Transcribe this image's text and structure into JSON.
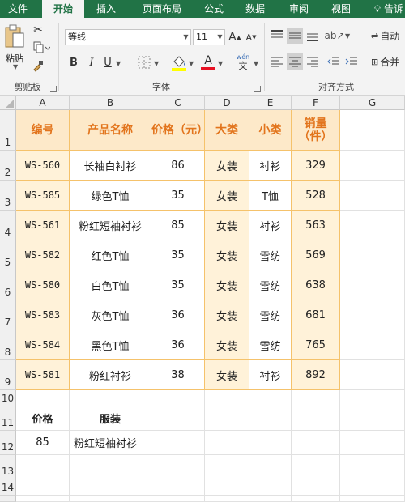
{
  "ribbon": {
    "tabs": [
      "文件",
      "开始",
      "插入",
      "页面布局",
      "公式",
      "数据",
      "审阅",
      "视图"
    ],
    "tell_me": "告诉",
    "paste_label": "粘贴",
    "font_name": "等线",
    "font_size": "11",
    "increase_font": "A",
    "decrease_font": "A",
    "bold": "B",
    "italic": "I",
    "underline": "U",
    "font_color_letter": "A",
    "phonetic_label": "wén",
    "wrap_label": "自动",
    "merge_label": "合并",
    "groups": {
      "clipboard": "剪贴板",
      "font": "字体",
      "alignment": "对齐方式"
    }
  },
  "columns": [
    "A",
    "B",
    "C",
    "D",
    "E",
    "F",
    "G"
  ],
  "rows": [
    "1",
    "2",
    "3",
    "4",
    "5",
    "6",
    "7",
    "8",
    "9",
    "10",
    "11",
    "12",
    "13",
    "14"
  ],
  "table": {
    "headers": [
      "编号",
      "产品名称",
      "价格（元）",
      "大类",
      "小类",
      "销量（件）"
    ],
    "rows": [
      [
        "WS-560",
        "长袖白衬衫",
        "86",
        "女装",
        "衬衫",
        "329"
      ],
      [
        "WS-585",
        "绿色T恤",
        "35",
        "女装",
        "T恤",
        "528"
      ],
      [
        "WS-561",
        "粉红短袖衬衫",
        "85",
        "女装",
        "衬衫",
        "563"
      ],
      [
        "WS-582",
        "红色T恤",
        "35",
        "女装",
        "雪纺",
        "569"
      ],
      [
        "WS-580",
        "白色T恤",
        "35",
        "女装",
        "雪纺",
        "638"
      ],
      [
        "WS-583",
        "灰色T恤",
        "36",
        "女装",
        "雪纺",
        "681"
      ],
      [
        "WS-584",
        "黑色T恤",
        "36",
        "女装",
        "雪纺",
        "765"
      ],
      [
        "WS-581",
        "粉红衬衫",
        "38",
        "女装",
        "衬衫",
        "892"
      ]
    ]
  },
  "lookup": {
    "price_label": "价格",
    "clothing_label": "服装",
    "price_value": "85",
    "clothing_value": "粉红短袖衬衫"
  }
}
